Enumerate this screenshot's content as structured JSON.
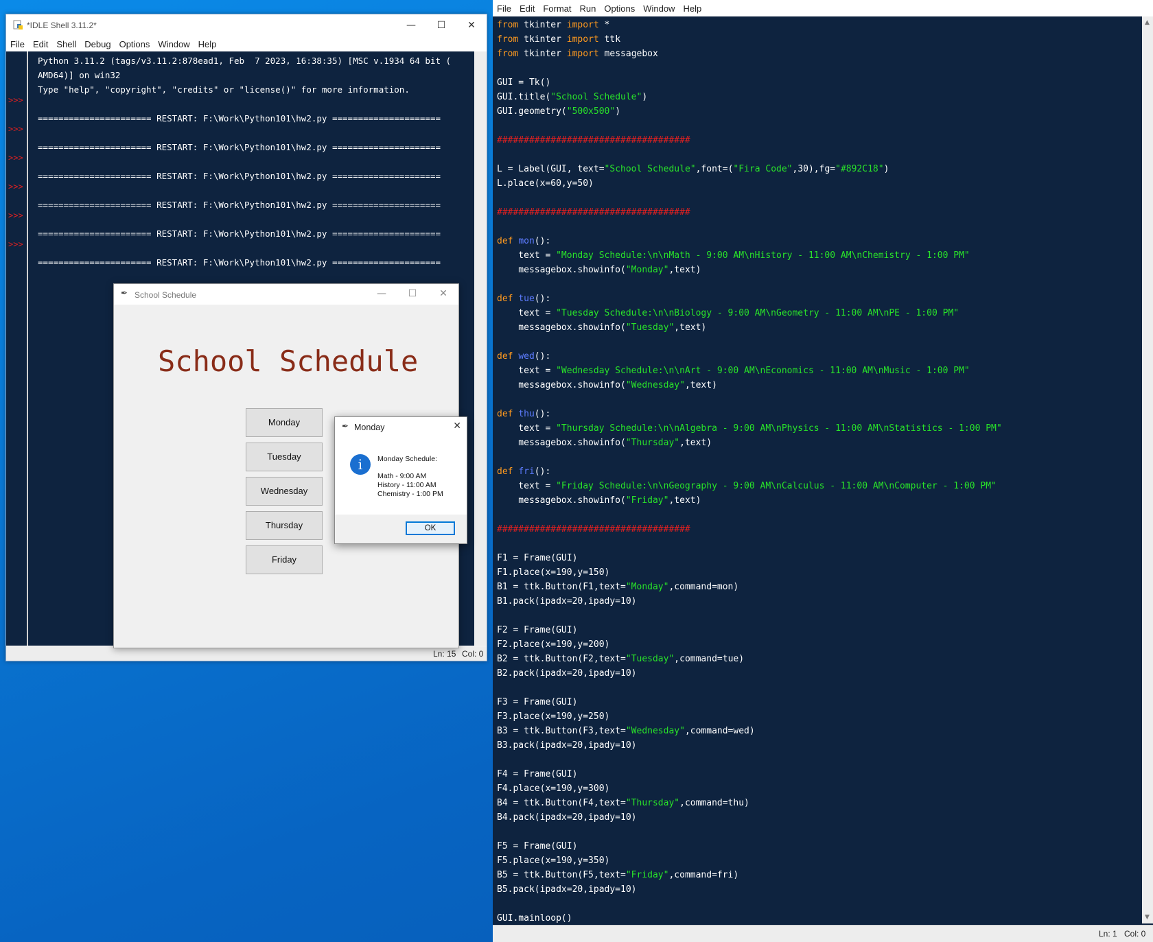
{
  "editor": {
    "menu": [
      "File",
      "Edit",
      "Format",
      "Run",
      "Options",
      "Window",
      "Help"
    ],
    "status": {
      "ln": "Ln: 1",
      "col": "Col: 0"
    },
    "code_lines": [
      [
        [
          "kw",
          "from"
        ],
        [
          "t",
          " tkinter "
        ],
        [
          "kw",
          "import"
        ],
        [
          "t",
          " *"
        ]
      ],
      [
        [
          "kw",
          "from"
        ],
        [
          "t",
          " tkinter "
        ],
        [
          "kw",
          "import"
        ],
        [
          "t",
          " ttk"
        ]
      ],
      [
        [
          "kw",
          "from"
        ],
        [
          "t",
          " tkinter "
        ],
        [
          "kw",
          "import"
        ],
        [
          "t",
          " messagebox"
        ]
      ],
      [],
      [
        [
          "t",
          "GUI = Tk()"
        ]
      ],
      [
        [
          "t",
          "GUI.title("
        ],
        [
          "str",
          "\"School Schedule\""
        ],
        [
          "t",
          ")"
        ]
      ],
      [
        [
          "t",
          "GUI.geometry("
        ],
        [
          "str",
          "\"500x500\""
        ],
        [
          "t",
          ")"
        ]
      ],
      [],
      [
        [
          "cm",
          "####################################"
        ]
      ],
      [],
      [
        [
          "t",
          "L = Label(GUI, text="
        ],
        [
          "str",
          "\"School Schedule\""
        ],
        [
          "t",
          ",font=("
        ],
        [
          "str",
          "\"Fira Code\""
        ],
        [
          "t",
          ",30),fg="
        ],
        [
          "str",
          "\"#892C18\""
        ],
        [
          "t",
          ")"
        ]
      ],
      [
        [
          "t",
          "L.place(x=60,y=50)"
        ]
      ],
      [],
      [
        [
          "cm",
          "####################################"
        ]
      ],
      [],
      [
        [
          "kw",
          "def"
        ],
        [
          "t",
          " "
        ],
        [
          "fn",
          "mon"
        ],
        [
          "t",
          "():"
        ]
      ],
      [
        [
          "t",
          "    text = "
        ],
        [
          "str",
          "\"Monday Schedule:\\n\\nMath - 9:00 AM\\nHistory - 11:00 AM\\nChemistry - 1:00 PM\""
        ]
      ],
      [
        [
          "t",
          "    messagebox.showinfo("
        ],
        [
          "str",
          "\"Monday\""
        ],
        [
          "t",
          ",text)"
        ]
      ],
      [],
      [
        [
          "kw",
          "def"
        ],
        [
          "t",
          " "
        ],
        [
          "fn",
          "tue"
        ],
        [
          "t",
          "():"
        ]
      ],
      [
        [
          "t",
          "    text = "
        ],
        [
          "str",
          "\"Tuesday Schedule:\\n\\nBiology - 9:00 AM\\nGeometry - 11:00 AM\\nPE - 1:00 PM\""
        ]
      ],
      [
        [
          "t",
          "    messagebox.showinfo("
        ],
        [
          "str",
          "\"Tuesday\""
        ],
        [
          "t",
          ",text)"
        ]
      ],
      [],
      [
        [
          "kw",
          "def"
        ],
        [
          "t",
          " "
        ],
        [
          "fn",
          "wed"
        ],
        [
          "t",
          "():"
        ]
      ],
      [
        [
          "t",
          "    text = "
        ],
        [
          "str",
          "\"Wednesday Schedule:\\n\\nArt - 9:00 AM\\nEconomics - 11:00 AM\\nMusic - 1:00 PM\""
        ]
      ],
      [
        [
          "t",
          "    messagebox.showinfo("
        ],
        [
          "str",
          "\"Wednesday\""
        ],
        [
          "t",
          ",text)"
        ]
      ],
      [],
      [
        [
          "kw",
          "def"
        ],
        [
          "t",
          " "
        ],
        [
          "fn",
          "thu"
        ],
        [
          "t",
          "():"
        ]
      ],
      [
        [
          "t",
          "    text = "
        ],
        [
          "str",
          "\"Thursday Schedule:\\n\\nAlgebra - 9:00 AM\\nPhysics - 11:00 AM\\nStatistics - 1:00 PM\""
        ]
      ],
      [
        [
          "t",
          "    messagebox.showinfo("
        ],
        [
          "str",
          "\"Thursday\""
        ],
        [
          "t",
          ",text)"
        ]
      ],
      [],
      [
        [
          "kw",
          "def"
        ],
        [
          "t",
          " "
        ],
        [
          "fn",
          "fri"
        ],
        [
          "t",
          "():"
        ]
      ],
      [
        [
          "t",
          "    text = "
        ],
        [
          "str",
          "\"Friday Schedule:\\n\\nGeography - 9:00 AM\\nCalculus - 11:00 AM\\nComputer - 1:00 PM\""
        ]
      ],
      [
        [
          "t",
          "    messagebox.showinfo("
        ],
        [
          "str",
          "\"Friday\""
        ],
        [
          "t",
          ",text)"
        ]
      ],
      [],
      [
        [
          "cm",
          "####################################"
        ]
      ],
      [],
      [
        [
          "t",
          "F1 = Frame(GUI)"
        ]
      ],
      [
        [
          "t",
          "F1.place(x=190,y=150)"
        ]
      ],
      [
        [
          "t",
          "B1 = ttk.Button(F1,text="
        ],
        [
          "str",
          "\"Monday\""
        ],
        [
          "t",
          ",command=mon)"
        ]
      ],
      [
        [
          "t",
          "B1.pack(ipadx=20,ipady=10)"
        ]
      ],
      [],
      [
        [
          "t",
          "F2 = Frame(GUI)"
        ]
      ],
      [
        [
          "t",
          "F2.place(x=190,y=200)"
        ]
      ],
      [
        [
          "t",
          "B2 = ttk.Button(F2,text="
        ],
        [
          "str",
          "\"Tuesday\""
        ],
        [
          "t",
          ",command=tue)"
        ]
      ],
      [
        [
          "t",
          "B2.pack(ipadx=20,ipady=10)"
        ]
      ],
      [],
      [
        [
          "t",
          "F3 = Frame(GUI)"
        ]
      ],
      [
        [
          "t",
          "F3.place(x=190,y=250)"
        ]
      ],
      [
        [
          "t",
          "B3 = ttk.Button(F3,text="
        ],
        [
          "str",
          "\"Wednesday\""
        ],
        [
          "t",
          ",command=wed)"
        ]
      ],
      [
        [
          "t",
          "B3.pack(ipadx=20,ipady=10)"
        ]
      ],
      [],
      [
        [
          "t",
          "F4 = Frame(GUI)"
        ]
      ],
      [
        [
          "t",
          "F4.place(x=190,y=300)"
        ]
      ],
      [
        [
          "t",
          "B4 = ttk.Button(F4,text="
        ],
        [
          "str",
          "\"Thursday\""
        ],
        [
          "t",
          ",command=thu)"
        ]
      ],
      [
        [
          "t",
          "B4.pack(ipadx=20,ipady=10)"
        ]
      ],
      [],
      [
        [
          "t",
          "F5 = Frame(GUI)"
        ]
      ],
      [
        [
          "t",
          "F5.place(x=190,y=350)"
        ]
      ],
      [
        [
          "t",
          "B5 = ttk.Button(F5,text="
        ],
        [
          "str",
          "\"Friday\""
        ],
        [
          "t",
          ",command=fri)"
        ]
      ],
      [
        [
          "t",
          "B5.pack(ipadx=20,ipady=10)"
        ]
      ],
      [],
      [
        [
          "t",
          "GUI.mainloop()"
        ]
      ]
    ]
  },
  "shell": {
    "title": "*IDLE Shell 3.11.2*",
    "menu": [
      "File",
      "Edit",
      "Shell",
      "Debug",
      "Options",
      "Window",
      "Help"
    ],
    "banner": [
      "Python 3.11.2 (tags/v3.11.2:878ead1, Feb  7 2023, 16:38:35) [MSC v.1934 64 bit (",
      "AMD64)] on win32",
      "Type \"help\", \"copyright\", \"credits\" or \"license()\" for more information."
    ],
    "prompt": ">>>",
    "restart_line": "====================== RESTART: F:\\Work\\Python101\\hw2.py =====================",
    "restart_count": 6,
    "status": {
      "ln": "Ln: 15",
      "col": "Col: 0"
    }
  },
  "app": {
    "title": "School Schedule",
    "heading": "School Schedule",
    "heading_color": "#892C18",
    "buttons": [
      "Monday",
      "Tuesday",
      "Wednesday",
      "Thursday",
      "Friday"
    ]
  },
  "messagebox": {
    "title": "Monday",
    "icon": "info-icon",
    "heading": "Monday Schedule:",
    "lines": [
      "Math - 9:00 AM",
      "History - 11:00 AM",
      "Chemistry - 1:00 PM"
    ],
    "ok_label": "OK"
  },
  "icons": {
    "minimize": "minimize-icon",
    "maximize": "maximize-icon",
    "close": "close-icon",
    "feather": "tk-feather-icon"
  }
}
